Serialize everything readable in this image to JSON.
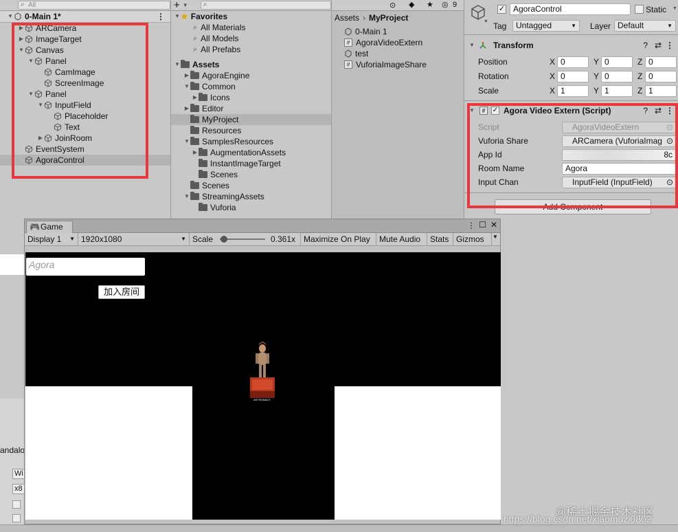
{
  "hierarchy": {
    "search_placeholder": "All",
    "scene": "0-Main 1*",
    "items": [
      "ARCamera",
      "ImageTarget",
      "Canvas",
      "Panel",
      "CamImage",
      "ScreenImage",
      "Panel",
      "InputField",
      "Placeholder",
      "Text",
      "JoinRoom",
      "EventSystem",
      "AgoraControl"
    ],
    "left_labels": [
      "andalo",
      "Wi",
      "x8"
    ]
  },
  "project": {
    "add_label": "+",
    "search_placeholder": "",
    "hidden_count": "9",
    "favorites_label": "Favorites",
    "favorites": [
      "All Materials",
      "All Models",
      "All Prefabs"
    ],
    "assets_label": "Assets",
    "tree": [
      "AgoraEngine",
      "Common",
      "Icons",
      "Editor",
      "MyProject",
      "Resources",
      "SamplesResources",
      "AugmentationAssets",
      "InstantImageTarget",
      "Scenes",
      "Scenes",
      "StreamingAssets",
      "Vuforia"
    ],
    "breadcrumb_root": "Assets",
    "breadcrumb_current": "MyProject",
    "files": [
      "0-Main 1",
      "AgoraVideoExtern",
      "test",
      "VuforiaImageShare"
    ]
  },
  "inspector": {
    "object_name": "AgoraControl",
    "static_label": "Static",
    "tag_label": "Tag",
    "tag_value": "Untagged",
    "layer_label": "Layer",
    "layer_value": "Default",
    "transform_title": "Transform",
    "position_label": "Position",
    "rotation_label": "Rotation",
    "scale_label": "Scale",
    "position": [
      "0",
      "0",
      "0"
    ],
    "rotation": [
      "0",
      "0",
      "0"
    ],
    "scale": [
      "1",
      "1",
      "1"
    ],
    "component_title": "Agora Video Extern (Script)",
    "script_label": "Script",
    "script_value": "AgoraVideoExtern",
    "vuforia_label": "Vuforia Share",
    "vuforia_value": "ARCamera (VuforiaImag",
    "appid_label": "App Id",
    "appid_value": "8c",
    "room_label": "Room Name",
    "room_value": "Agora",
    "input_label": "Input Chan",
    "input_value": "InputField (InputField)",
    "add_component": "Add Component"
  },
  "game": {
    "tab": "Game",
    "display": "Display 1",
    "resolution": "1920x1080",
    "scale_label": "Scale",
    "scale_value": "0.361x",
    "maximize": "Maximize On Play",
    "mute": "Mute Audio",
    "stats": "Stats",
    "gizmos": "Gizmos",
    "input_placeholder": "Agora",
    "join_button": "加入房间",
    "marker_text": "ASTRONAUT"
  },
  "watermark": "https://blog.csdn.net/xiaomuzi0802",
  "watermark_logo": "@稀土掘金技术社区",
  "colors": {
    "highlight": "#e8383d",
    "panel": "#c8c8c8"
  }
}
